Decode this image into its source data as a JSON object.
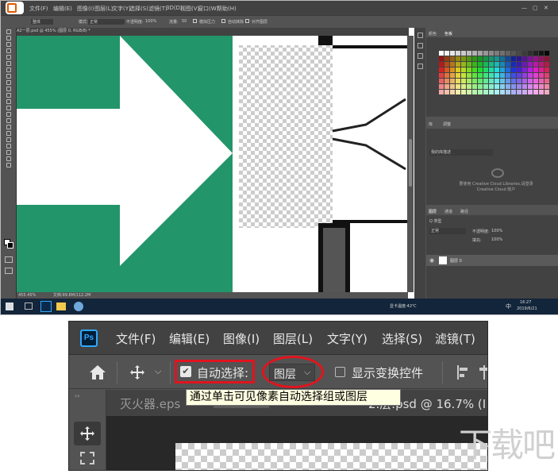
{
  "top_screenshot": {
    "menu": [
      "文件(F)",
      "编辑(E)",
      "图像(I)",
      "图层(L)",
      "文字(Y)",
      "选择(S)",
      "滤镜(T)",
      "3D(D)",
      "视图(V)",
      "窗口(W)",
      "帮助(H)"
    ],
    "options": {
      "layer_select": "整体",
      "mode_label": "模式:",
      "mode_value": "正常",
      "opacity_label": "不透明度:",
      "opacity_value": "100%",
      "flow_label": "流量:",
      "flow_value": "50",
      "option_a": "模拟压力",
      "option_b": "自动抹除",
      "option_c": "对齐图层"
    },
    "doc_tab": "A2一层.psd @ 455% (图层 0, RGB/8) *",
    "status": {
      "zoom": "455.45%",
      "doc_size": "文档:99.6M/112.2M"
    },
    "right_panels": {
      "color_tabs": [
        "颜色",
        "色板"
      ],
      "adjust_tabs": [
        "库",
        "调整"
      ],
      "library_dropdown": "我的库描述",
      "library_message": "要使用 Creative Cloud Libraries,请登录 Creative Cloud 账户",
      "layers_tabs": [
        "图层",
        "通道",
        "路径"
      ],
      "kind_label": "Q 类型",
      "blend_mode": "正常",
      "opacity_label": "不透明度:",
      "opacity_value": "100%",
      "fill_label": "填充:",
      "fill_value": "100%",
      "layer_name": "图层 0"
    },
    "taskbar": {
      "weather": "显卡温度:42℃",
      "time": "16:27",
      "date": "2019/6/21",
      "lang": "中"
    }
  },
  "ps_window": {
    "logo": "Ps",
    "menu": [
      "文件(F)",
      "编辑(E)",
      "图像(I)",
      "图层(L)",
      "文字(Y)",
      "选择(S)",
      "滤镜(T)"
    ],
    "options_bar": {
      "auto_select_label": "自动选择:",
      "auto_select_checked": true,
      "target_value": "图层",
      "show_transform_label": "显示变换控件",
      "show_transform_checked": false
    },
    "tooltip": "通过单击可见像素自动选择组或图层",
    "doc_tabs": [
      "灭火器.eps",
      "2.层.psd @ 16.7% (I"
    ]
  },
  "watermark": "下载吧",
  "colors": {
    "ps_dark": "#424242",
    "ps_mid": "#535353",
    "highlight_red": "#e0141e",
    "tooltip_bg": "#ffffe1",
    "sign_green": "#23956a"
  }
}
